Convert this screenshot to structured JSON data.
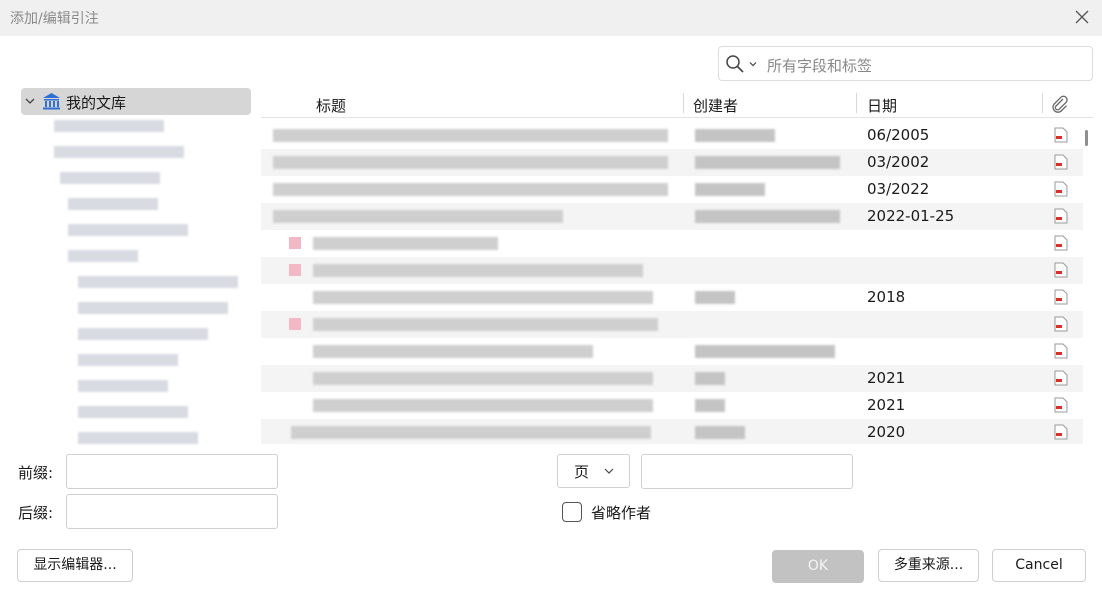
{
  "window": {
    "title": "添加/编辑引注"
  },
  "search": {
    "placeholder": "所有字段和标签"
  },
  "tree": {
    "root_label": "我的文库"
  },
  "table": {
    "columns": {
      "title": "标题",
      "creator": "创建者",
      "date": "日期"
    },
    "rows": [
      {
        "date": "06/2005"
      },
      {
        "date": "03/2002"
      },
      {
        "date": "03/2022"
      },
      {
        "date": "2022-01-25"
      },
      {
        "date": ""
      },
      {
        "date": ""
      },
      {
        "date": "2018"
      },
      {
        "date": ""
      },
      {
        "date": ""
      },
      {
        "date": "2021"
      },
      {
        "date": "2021"
      },
      {
        "date": "2020"
      }
    ]
  },
  "form": {
    "prefix_label": "前缀:",
    "suffix_label": "后缀:",
    "locator_select": "页",
    "omit_author_label": "省略作者"
  },
  "buttons": {
    "show_editor": "显示编辑器...",
    "ok": "OK",
    "multiple_sources": "多重来源...",
    "cancel": "Cancel"
  },
  "icons": {
    "close": "close-icon",
    "search": "search-icon",
    "library": "library-icon",
    "attachment": "paperclip-icon",
    "pdf": "pdf-icon"
  },
  "colors": {
    "selected_tree_bg": "#d6d6d6",
    "ok_disabled": "#c2c2c2",
    "pdf_red": "#d9302c"
  }
}
